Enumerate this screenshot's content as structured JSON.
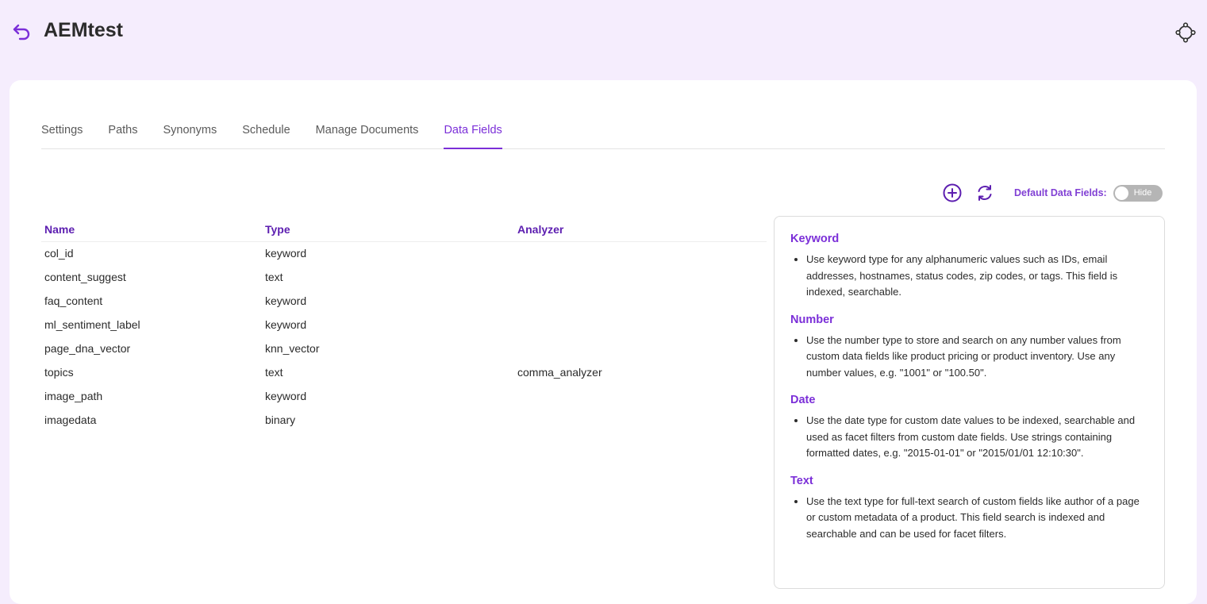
{
  "header": {
    "title": "AEMtest",
    "back_icon": "back-arrow-icon",
    "settings_icon": "settings-cog-icon",
    "accent_color": "#7b2fd8"
  },
  "tabs": [
    {
      "label": "Settings",
      "active": false
    },
    {
      "label": "Paths",
      "active": false
    },
    {
      "label": "Synonyms",
      "active": false
    },
    {
      "label": "Schedule",
      "active": false
    },
    {
      "label": "Manage Documents",
      "active": false
    },
    {
      "label": "Data Fields",
      "active": true
    }
  ],
  "toolbar": {
    "add_icon": "plus-circle-icon",
    "refresh_icon": "refresh-icon",
    "default_fields_label": "Default Data Fields:",
    "toggle_text": "Hide",
    "toggle_on": false
  },
  "table": {
    "headers": {
      "name": "Name",
      "type": "Type",
      "analyzer": "Analyzer"
    },
    "rows": [
      {
        "name": "col_id",
        "type": "keyword",
        "analyzer": ""
      },
      {
        "name": "content_suggest",
        "type": "text",
        "analyzer": ""
      },
      {
        "name": "faq_content",
        "type": "keyword",
        "analyzer": ""
      },
      {
        "name": "ml_sentiment_label",
        "type": "keyword",
        "analyzer": ""
      },
      {
        "name": "page_dna_vector",
        "type": "knn_vector",
        "analyzer": ""
      },
      {
        "name": "topics",
        "type": "text",
        "analyzer": "comma_analyzer"
      },
      {
        "name": "image_path",
        "type": "keyword",
        "analyzer": ""
      },
      {
        "name": "imagedata",
        "type": "binary",
        "analyzer": ""
      }
    ]
  },
  "info": {
    "sections": [
      {
        "title": "Keyword",
        "text": "Use keyword type for any alphanumeric values such as IDs, email addresses, hostnames, status codes, zip codes, or tags. This field is indexed, searchable."
      },
      {
        "title": "Number",
        "text": "Use the number type to store and search on any number values from custom data fields like product pricing or product inventory. Use any number values, e.g. \"1001\" or \"100.50\"."
      },
      {
        "title": "Date",
        "text": "Use the date type for custom date values to be indexed, searchable and used as facet filters from custom date fields. Use strings containing formatted dates, e.g. \"2015-01-01\" or \"2015/01/01 12:10:30\"."
      },
      {
        "title": "Text",
        "text": "Use the text type for full-text search of custom fields like author of a page or custom metadata of a product. This field search is indexed and searchable and can be used for facet filters."
      }
    ]
  }
}
